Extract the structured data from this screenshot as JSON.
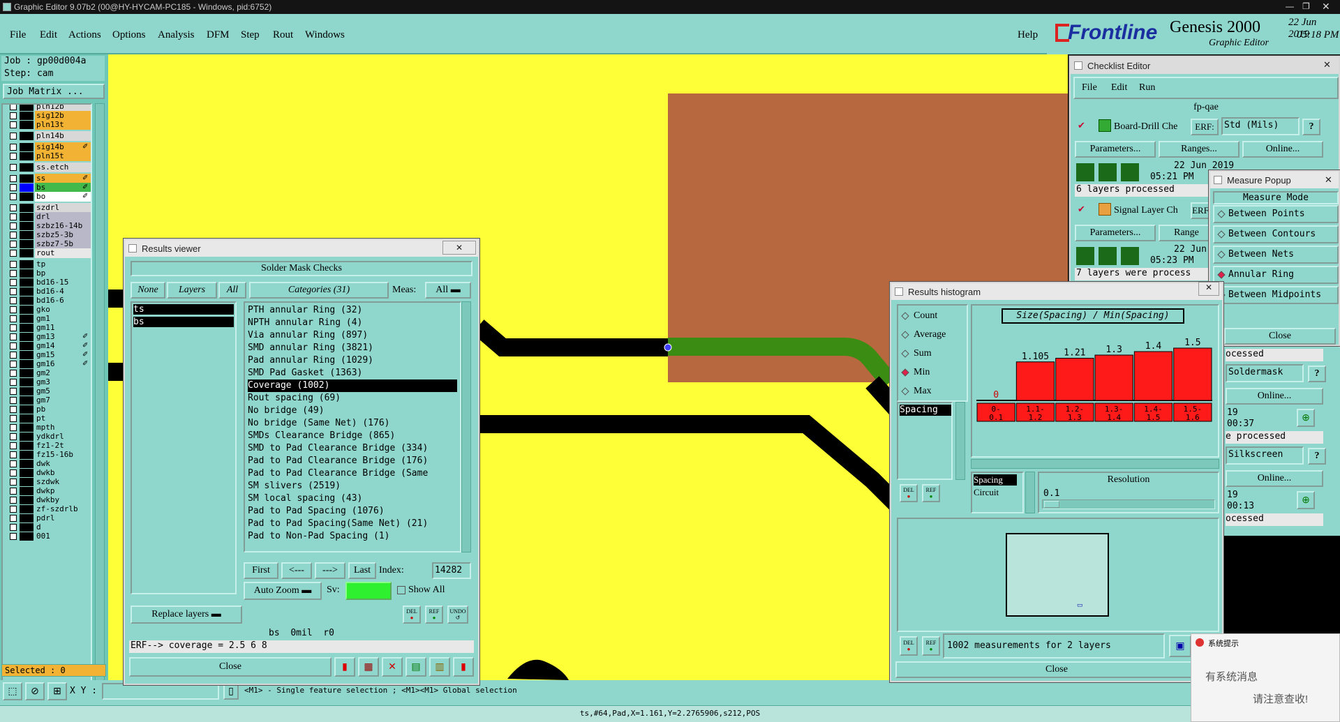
{
  "window": {
    "title": "Graphic Editor 9.07b2 (00@HY-HYCAM-PC185 - Windows, pid:6752)"
  },
  "menu": {
    "items": [
      "File",
      "Edit",
      "Actions",
      "Options",
      "Analysis",
      "DFM",
      "Step",
      "Rout",
      "Windows"
    ],
    "help": "Help"
  },
  "logo": {
    "brand": "Frontline",
    "product": "Genesis 2000",
    "subtitle": "Graphic Editor",
    "date": "22 Jun 2019",
    "time": "05:18 PM"
  },
  "job": {
    "job_label": "Job : gp00d004a",
    "step_label": "Step: cam",
    "matrix_button": "Job Matrix ..."
  },
  "layers": [
    {
      "name": "pln12b",
      "color": "#d8d8d8"
    },
    {
      "name": "sig12b",
      "color": "#f2b233"
    },
    {
      "name": "pln13t",
      "color": "#f2b233"
    },
    {
      "name": "pln14b",
      "color": "#d8d8d8"
    },
    {
      "name": "sig14b",
      "color": "#f2b233",
      "mark": "✐"
    },
    {
      "name": "pln15t",
      "color": "#f2b233"
    },
    {
      "name": "ss.etch",
      "color": "#d8d8d8"
    },
    {
      "name": "ss",
      "color": "#f2b233",
      "mark": "✐"
    },
    {
      "name": "bs",
      "color": "#43b84b",
      "mark": "✐",
      "active": true
    },
    {
      "name": "bo",
      "color": "#ffffff",
      "mark": "✐"
    },
    {
      "name": "szdrl",
      "color": "#d8d8d8"
    },
    {
      "name": "drl",
      "color": "#b8b8c8"
    },
    {
      "name": "szbz16-14b",
      "color": "#b8b8c8"
    },
    {
      "name": "szbz5-3b",
      "color": "#b8b8c8"
    },
    {
      "name": "szbz7-5b",
      "color": "#b8b8c8"
    },
    {
      "name": "rout",
      "color": "#e8e8e8"
    },
    {
      "name": "tp",
      "color": "#8fd6cc"
    },
    {
      "name": "bp",
      "color": "#8fd6cc"
    },
    {
      "name": "bd16-15",
      "color": "#8fd6cc"
    },
    {
      "name": "bd16-4",
      "color": "#8fd6cc"
    },
    {
      "name": "bd16-6",
      "color": "#8fd6cc"
    },
    {
      "name": "gko",
      "color": "#8fd6cc"
    },
    {
      "name": "gm1",
      "color": "#8fd6cc"
    },
    {
      "name": "gm11",
      "color": "#8fd6cc"
    },
    {
      "name": "gm13",
      "color": "#8fd6cc",
      "mark": "✐"
    },
    {
      "name": "gm14",
      "color": "#8fd6cc",
      "mark": "✐"
    },
    {
      "name": "gm15",
      "color": "#8fd6cc",
      "mark": "✐"
    },
    {
      "name": "gm16",
      "color": "#8fd6cc",
      "mark": "✐"
    },
    {
      "name": "gm2",
      "color": "#8fd6cc"
    },
    {
      "name": "gm3",
      "color": "#8fd6cc"
    },
    {
      "name": "gm5",
      "color": "#8fd6cc"
    },
    {
      "name": "gm7",
      "color": "#8fd6cc"
    },
    {
      "name": "pb",
      "color": "#8fd6cc"
    },
    {
      "name": "pt",
      "color": "#8fd6cc"
    },
    {
      "name": "mpth",
      "color": "#8fd6cc"
    },
    {
      "name": "ydkdrl",
      "color": "#8fd6cc"
    },
    {
      "name": "fz1-2t",
      "color": "#8fd6cc"
    },
    {
      "name": "fz15-16b",
      "color": "#8fd6cc"
    },
    {
      "name": "dwk",
      "color": "#8fd6cc"
    },
    {
      "name": "dwkb",
      "color": "#8fd6cc"
    },
    {
      "name": "szdwk",
      "color": "#8fd6cc"
    },
    {
      "name": "dwkp",
      "color": "#8fd6cc"
    },
    {
      "name": "dwkby",
      "color": "#8fd6cc"
    },
    {
      "name": "zf-szdrlb",
      "color": "#8fd6cc"
    },
    {
      "name": "pdrl",
      "color": "#8fd6cc"
    },
    {
      "name": "d",
      "color": "#8fd6cc"
    },
    {
      "name": "001",
      "color": "#8fd6cc"
    }
  ],
  "selected": "Selected : 0",
  "status": {
    "xy_label": "X Y :",
    "hint": "<M1> - Single feature selection ; <M1><M1> Global selection",
    "coords": "ts,#64,Pad,X=1.161,Y=2.2765906,s212,POS"
  },
  "results_viewer": {
    "title": "Results viewer",
    "header": "Solder Mask Checks",
    "none": "None",
    "layers": "Layers",
    "all": "All",
    "categories_label": "Categories (31)",
    "meas_label": "Meas:",
    "meas_value": "All",
    "layer_list": [
      "ts",
      "bs"
    ],
    "categories": [
      "PTH annular Ring (32)",
      "NPTH annular Ring (4)",
      "Via annular Ring (897)",
      "SMD annular Ring (3821)",
      "Pad annular Ring (1029)",
      "SMD Pad Gasket (1363)",
      "Coverage (1002)",
      "Rout spacing (69)",
      "No bridge (49)",
      "No bridge (Same Net) (176)",
      "SMDs Clearance Bridge (865)",
      "SMD to Pad Clearance Bridge (334)",
      "Pad to Pad Clearance Bridge (176)",
      "Pad to Pad Clearance Bridge (Same",
      "SM slivers (2519)",
      "SM local spacing (43)",
      "Pad to Pad Spacing (1076)",
      "Pad to Pad Spacing(Same Net) (21)",
      "Pad to Non-Pad Spacing (1)"
    ],
    "selected_category": "Coverage (1002)",
    "first": "First",
    "prev": "<---",
    "next": "--->",
    "last": "Last",
    "index_label": "Index:",
    "index_value": "14282",
    "auto_zoom": "Auto Zoom",
    "sv_label": "Sv:",
    "show_all": "Show All",
    "replace_layers": "Replace layers",
    "info_line": "bs  0mil  r0",
    "erf_line": "ERF--> coverage = 2.5 6 8",
    "close": "Close",
    "del": "DEL",
    "ref": "REF",
    "undo": "UNDO"
  },
  "histogram": {
    "title": "Results histogram",
    "modes": [
      "Count",
      "Average",
      "Sum",
      "Min",
      "Max"
    ],
    "selected_mode": "Min",
    "measure_list": [
      "Spacing"
    ],
    "chart_title": "Size(Spacing) / Min(Spacing)",
    "bar_labels": [
      "0",
      "1.105",
      "1.21",
      "1.3",
      "1.4",
      "1.5"
    ],
    "bins": [
      "0-\n0.1",
      "1.1-\n1.2",
      "1.2-\n1.3",
      "1.3-\n1.4",
      "1.4-\n1.5",
      "1.5-\n1.6"
    ],
    "group_list": [
      "Spacing",
      "Circuit"
    ],
    "resolution_label": "Resolution",
    "resolution_value": "0.1",
    "summary": "1002 measurements for 2 layers",
    "close": "Close",
    "del": "DEL",
    "ref": "REF"
  },
  "chart_data": {
    "type": "bar",
    "title": "Size(Spacing) / Min(Spacing)",
    "categories": [
      "0-0.1",
      "1.1-1.2",
      "1.2-1.3",
      "1.3-1.4",
      "1.4-1.5",
      "1.5-1.6"
    ],
    "values": [
      0,
      1.105,
      1.21,
      1.3,
      1.4,
      1.5
    ],
    "ylim": [
      0,
      1.6
    ]
  },
  "checklist": {
    "title": "Checklist Editor",
    "menu": [
      "File",
      "Edit",
      "Run"
    ],
    "name": "fp-qae",
    "checks": [
      {
        "name": "Board-Drill Che",
        "erf_label": "ERF:",
        "erf_value": "Std (Mils)",
        "params": "Parameters...",
        "ranges": "Ranges...",
        "online": "Online...",
        "date": "22 Jun 2019",
        "time": "05:21 PM",
        "status": "6 layers processed"
      },
      {
        "name": "Signal Layer Ch",
        "erf_label": "ERF",
        "erf_value": "",
        "params": "Parameters...",
        "ranges": "Range",
        "online": "",
        "date": "22 Jun",
        "time": "05:23 PM",
        "status": "7 layers were process"
      }
    ],
    "right_col": {
      "proc1": "ocessed",
      "soldermask": "Soldermask",
      "online1": "Online...",
      "d1": "19",
      "t1": "00:37",
      "proc2": "e processed",
      "silkscreen": "Silkscreen",
      "online2": "Online...",
      "d2": "19",
      "t2": "00:13",
      "proc3": "ocessed"
    }
  },
  "measure": {
    "title": "Measure Popup",
    "header": "Measure Mode",
    "modes": [
      "Between Points",
      "Between Contours",
      "Between Nets",
      "Annular Ring",
      "Between Midpoints"
    ],
    "selected": "Annular Ring",
    "close": "Close"
  },
  "toast": {
    "title": "系统提示",
    "line1": "有系统消息",
    "line2": "请注意查收!"
  }
}
